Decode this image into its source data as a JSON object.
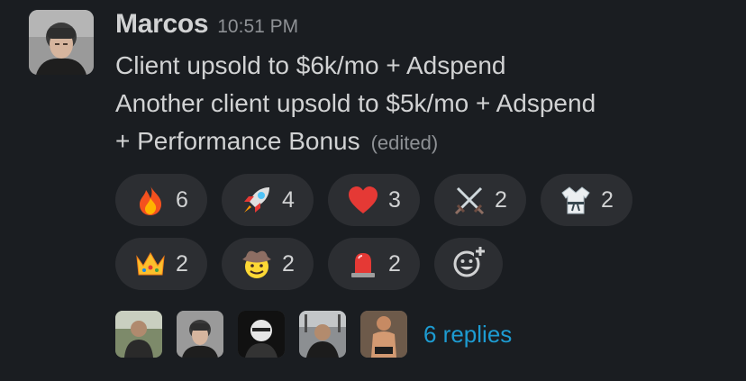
{
  "message": {
    "author": "Marcos",
    "timestamp": "10:51 PM",
    "lines": [
      "Client upsold to $6k/mo + Adspend",
      "Another client upsold to $5k/mo + Adspend",
      "+ Performance Bonus"
    ],
    "edited_label": "(edited)"
  },
  "reactions": [
    {
      "icon": "fire-icon",
      "count": "6"
    },
    {
      "icon": "rocket-icon",
      "count": "4"
    },
    {
      "icon": "heart-icon",
      "count": "3"
    },
    {
      "icon": "crossed-swords-icon",
      "count": "2"
    },
    {
      "icon": "martial-arts-uniform-icon",
      "count": "2"
    },
    {
      "icon": "crown-icon",
      "count": "2"
    },
    {
      "icon": "cowboy-face-icon",
      "count": "2"
    },
    {
      "icon": "rotating-light-icon",
      "count": "2"
    }
  ],
  "add_reaction_icon": "add-reaction-icon",
  "thread": {
    "replies_label": "6 replies"
  },
  "colors": {
    "background": "#1a1d21",
    "text": "#d1d2d3",
    "muted": "#8e9195",
    "pill": "#2c2e32",
    "link": "#1d9bd1"
  }
}
